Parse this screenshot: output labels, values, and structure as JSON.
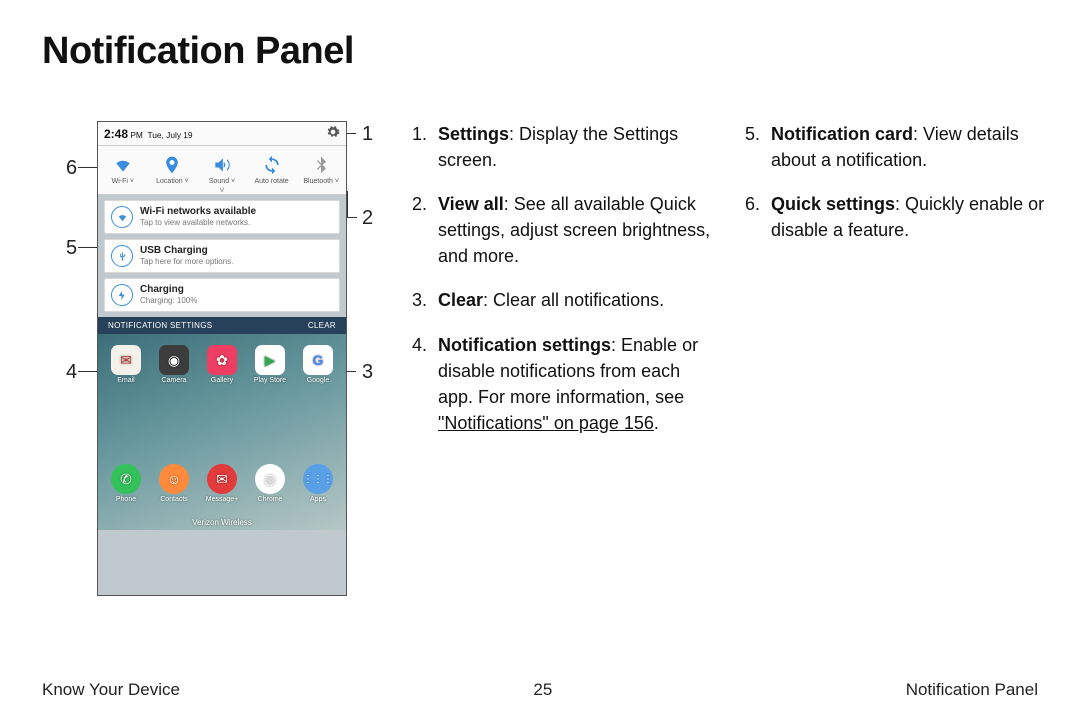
{
  "title": "Notification Panel",
  "footer": {
    "left": "Know Your Device",
    "center": "25",
    "right": "Notification Panel"
  },
  "callouts": {
    "n1": "1",
    "n2": "2",
    "n3": "3",
    "n4": "4",
    "n5": "5",
    "n6": "6"
  },
  "legend_col1": [
    {
      "num": "1.",
      "term": "Settings",
      "desc": ": Display the Settings screen."
    },
    {
      "num": "2.",
      "term": "View all",
      "desc": ": See all available Quick settings, adjust screen brightness, and more."
    },
    {
      "num": "3.",
      "term": "Clear",
      "desc": ": Clear all notifications."
    },
    {
      "num": "4.",
      "term": "Notification settings",
      "desc": ": Enable or disable notifications from each app. For more information, see ",
      "xref": "\"Notifications\" on page 156",
      "tail": "."
    }
  ],
  "legend_col2": [
    {
      "num": "5.",
      "term": "Notification card",
      "desc": ": View details about a notification."
    },
    {
      "num": "6.",
      "term": "Quick settings",
      "desc": ": Quickly enable or disable a feature."
    }
  ],
  "phone": {
    "time": "2:48",
    "ampm": "PM",
    "date": "Tue, July 19",
    "qs": [
      {
        "label": "Wi-Fi ˅",
        "state": "on",
        "name": "wifi"
      },
      {
        "label": "Location ˅",
        "state": "on",
        "name": "location"
      },
      {
        "label": "Sound ˅",
        "state": "on",
        "name": "sound"
      },
      {
        "label": "Auto rotate",
        "state": "on",
        "name": "rotate"
      },
      {
        "label": "Bluetooth ˅",
        "state": "off",
        "name": "bluetooth"
      }
    ],
    "cards": [
      {
        "title": "Wi-Fi networks available",
        "sub": "Tap to view available networks.",
        "icon": "wifi"
      },
      {
        "title": "USB Charging",
        "sub": "Tap here for more options.",
        "icon": "usb"
      },
      {
        "title": "Charging",
        "sub": "Charging: 100%",
        "icon": "bolt"
      }
    ],
    "nbar": {
      "left": "NOTIFICATION SETTINGS",
      "right": "CLEAR"
    },
    "apps_row1": [
      {
        "label": "Email",
        "bg": "#f4f0ea",
        "glyph": "✉"
      },
      {
        "label": "Camera",
        "bg": "#3c3c3c",
        "glyph": "◉"
      },
      {
        "label": "Gallery",
        "bg": "#ef3e63",
        "glyph": "✿"
      },
      {
        "label": "Play Store",
        "bg": "#ffffff",
        "glyph": "▶"
      },
      {
        "label": "Google",
        "bg": "#ffffff",
        "glyph": "G"
      }
    ],
    "apps_row2": [
      {
        "label": "Phone",
        "bg": "#33c15a",
        "glyph": "✆"
      },
      {
        "label": "Contacts",
        "bg": "#ff8a3c",
        "glyph": "☺"
      },
      {
        "label": "Message+",
        "bg": "#e33b3b",
        "glyph": "✉"
      },
      {
        "label": "Chrome",
        "bg": "#ffffff",
        "glyph": "◍"
      },
      {
        "label": "Apps",
        "bg": "#5aa0e6",
        "glyph": "⋮⋮"
      }
    ],
    "carrier": "Verizon Wireless"
  }
}
